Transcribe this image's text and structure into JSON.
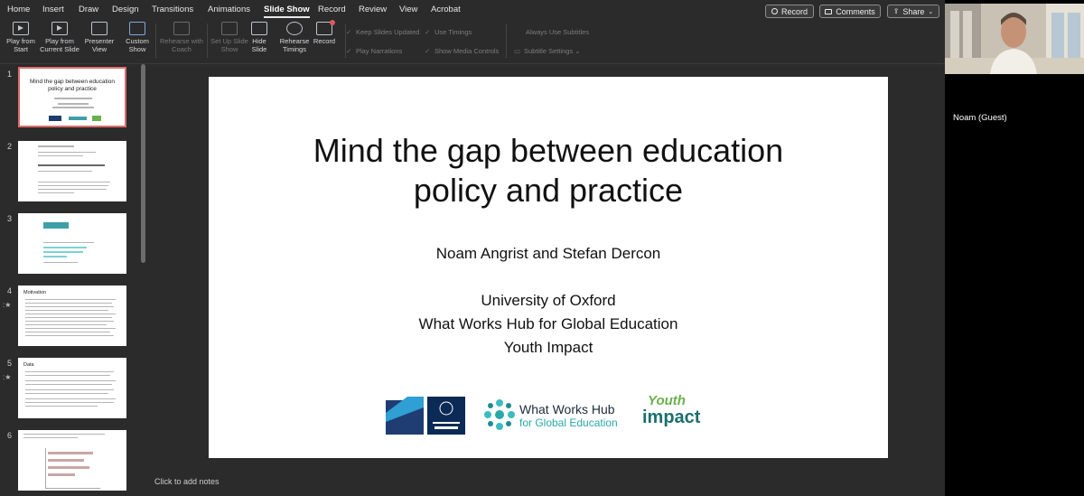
{
  "menu": {
    "tabs": [
      "Home",
      "Insert",
      "Draw",
      "Design",
      "Transitions",
      "Animations",
      "Slide Show",
      "Record",
      "Review",
      "View",
      "Acrobat"
    ],
    "active_tab": "Slide Show",
    "record_label": "Record",
    "comments_label": "Comments",
    "share_label": "Share"
  },
  "ribbon": {
    "play_from_start": "Play from Start",
    "play_from_current": "Play from Current Slide",
    "presenter_view": "Presenter View",
    "custom_show": "Custom Show",
    "rehearse_with_coach": "Rehearse with Coach",
    "set_up_slide_show": "Set Up Slide Show",
    "hide_slide": "Hide Slide",
    "rehearse_timings": "Rehearse Timings",
    "record": "Record",
    "keep_slides_updated": "Keep Slides Updated",
    "use_timings": "Use Timings",
    "always_use_subtitles": "Always Use Subtitles",
    "play_narrations": "Play Narrations",
    "show_media_controls": "Show Media Controls",
    "subtitle_settings": "Subtitle Settings"
  },
  "thumbnails": {
    "numbers": [
      "1",
      "2",
      "3",
      "4",
      "5",
      "6"
    ],
    "slide1_title": "Mind the gap between education policy and practice",
    "slide4_title": "Motivation",
    "slide5_title": "Data"
  },
  "slide": {
    "title_line1": "Mind the gap between education",
    "title_line2": "policy and practice",
    "authors": "Noam Angrist and Stefan Dercon",
    "affiliation1": "University of Oxford",
    "affiliation2": "What Works Hub for Global Education",
    "affiliation3": "Youth Impact",
    "logo_wwh_line1": "What Works Hub",
    "logo_wwh_line2": "for Global Education",
    "logo_youth": "Youth",
    "logo_impact": "impact"
  },
  "notes_placeholder": "Click to add notes",
  "video": {
    "participant_name": "Noam (Guest)"
  }
}
